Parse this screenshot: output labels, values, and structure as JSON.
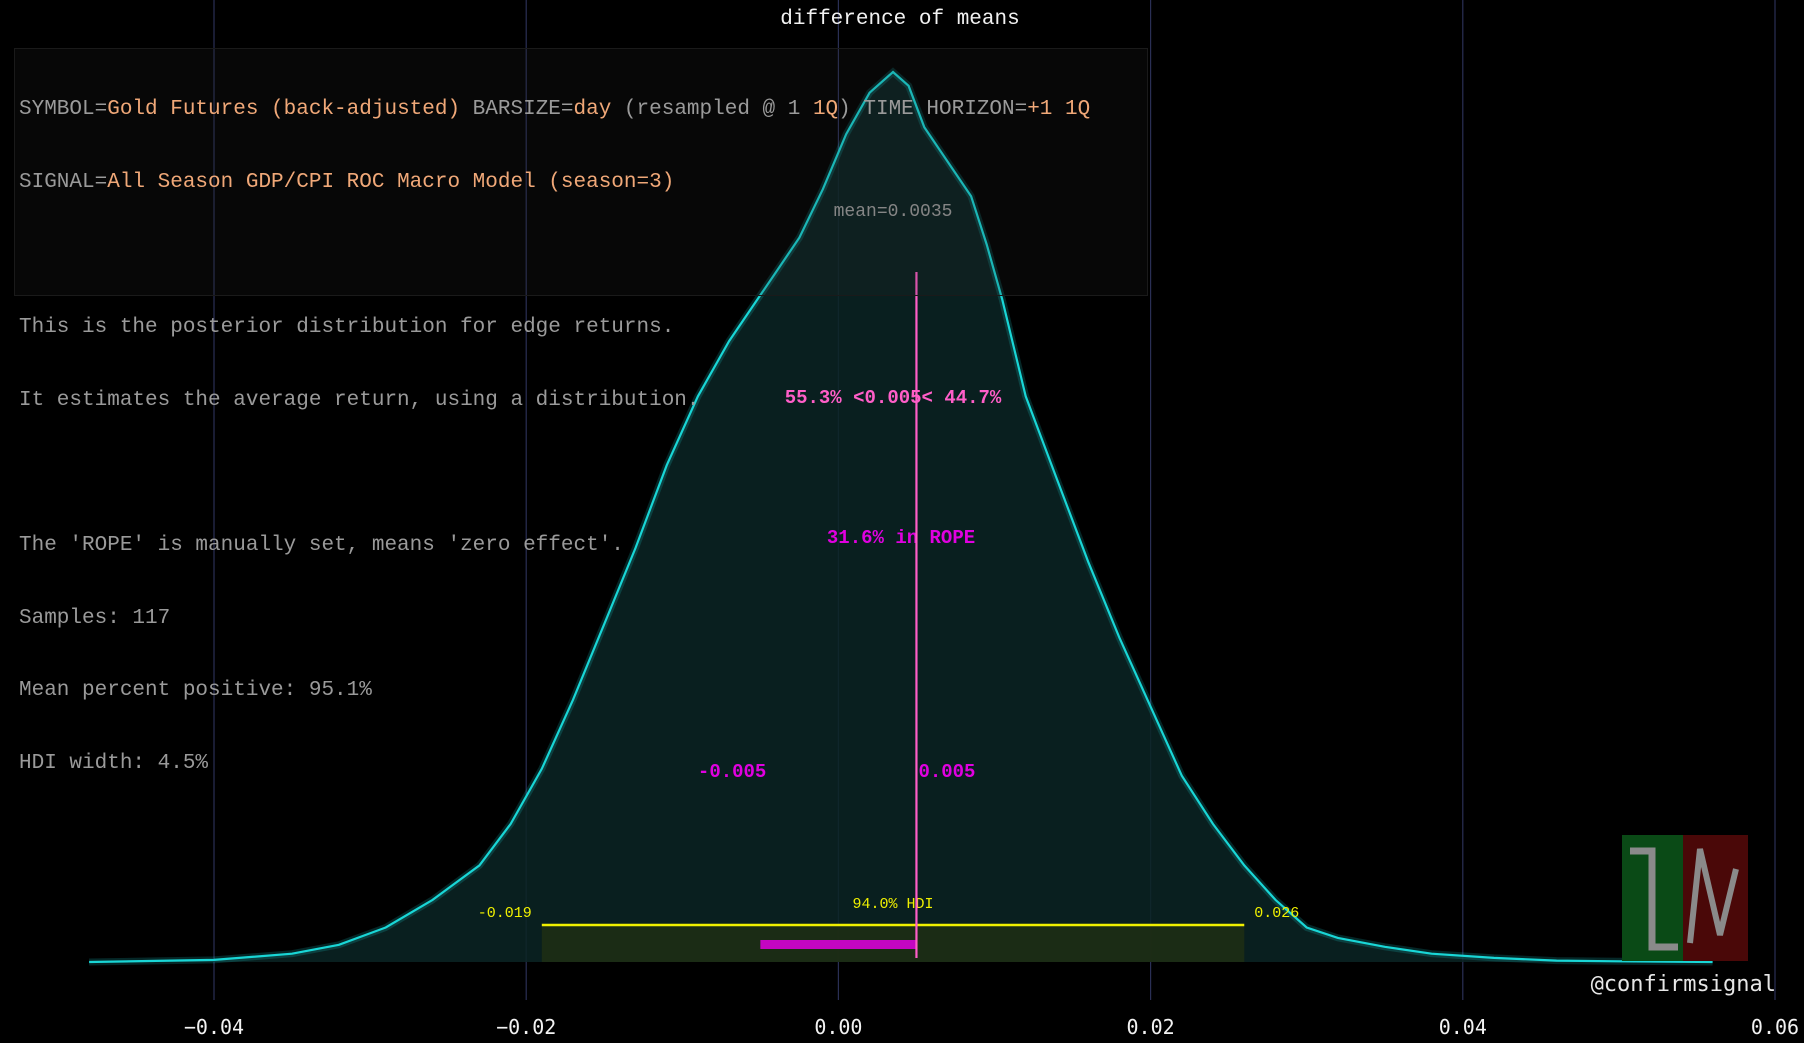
{
  "chart_data": {
    "type": "area",
    "title": "difference of means",
    "xlim": [
      -0.05,
      0.06
    ],
    "xticks": [
      -0.04,
      -0.02,
      0.0,
      0.02,
      0.04,
      0.06
    ],
    "xtick_labels": [
      "−0.04",
      "−0.02",
      "0.00",
      "0.02",
      "0.04",
      "0.06"
    ],
    "grid": "vertical",
    "density": {
      "x": [
        -0.048,
        -0.04,
        -0.035,
        -0.032,
        -0.029,
        -0.026,
        -0.023,
        -0.021,
        -0.019,
        -0.017,
        -0.015,
        -0.013,
        -0.011,
        -0.009,
        -0.007,
        -0.0055,
        -0.004,
        -0.0025,
        -0.001,
        0.0005,
        0.002,
        0.0035,
        0.0045,
        0.0055,
        0.007,
        0.0085,
        0.0095,
        0.0105,
        0.012,
        0.014,
        0.016,
        0.018,
        0.02,
        0.022,
        0.024,
        0.026,
        0.028,
        0.03,
        0.032,
        0.035,
        0.038,
        0.042,
        0.046,
        0.05,
        0.056
      ],
      "y": [
        0.0,
        0.003,
        0.012,
        0.025,
        0.05,
        0.09,
        0.14,
        0.2,
        0.28,
        0.38,
        0.49,
        0.6,
        0.72,
        0.82,
        0.9,
        0.95,
        1.0,
        1.05,
        1.12,
        1.2,
        1.26,
        1.29,
        1.27,
        1.21,
        1.16,
        1.11,
        1.04,
        0.96,
        0.82,
        0.7,
        0.58,
        0.47,
        0.37,
        0.27,
        0.2,
        0.14,
        0.09,
        0.05,
        0.035,
        0.022,
        0.012,
        0.006,
        0.002,
        0.001,
        0.0
      ]
    },
    "mean": 0.0035,
    "mean_label": "mean=0.0035",
    "reference_value": 0.005,
    "reference_label": "55.3% <0.005< 44.7%",
    "rope": [
      -0.005,
      0.005
    ],
    "rope_labels": [
      "-0.005",
      "0.005"
    ],
    "rope_text": "31.6% in ROPE",
    "hdi": [
      -0.019,
      0.026
    ],
    "hdi_labels": [
      "-0.019",
      "0.026"
    ],
    "hdi_text": "94.0% HDI"
  },
  "info": {
    "symbol_key": "SYMBOL=",
    "symbol_value": "Gold Futures (back-adjusted)",
    "barsize_key": " BARSIZE=",
    "barsize_value": "day",
    "resample_text": " (resampled @ 1 ",
    "resample_value": "1Q",
    "resample_close": ") TIME HORIZON=",
    "horizon_value": "+1 1Q",
    "signal_key": "SIGNAL=",
    "signal_value": "All Season GDP/CPI ROC Macro Model (season=3)",
    "desc_line1": "This is the posterior distribution for edge returns.",
    "desc_line2": "It estimates the average return, using a distribution.",
    "rope_note": "The 'ROPE' is manually set, means 'zero effect'.",
    "samples": "Samples: 117",
    "mean_positive": "Mean percent positive: 95.1%",
    "hdi_width": "HDI width: 4.5%"
  },
  "watermark": "@confirmsignal",
  "colors": {
    "background": "#000000",
    "curve": "#19d6d6",
    "curve_fill": "#0a2424",
    "grid": "#2a2f55",
    "rope": "#e000e0",
    "reference": "#ff5ec8",
    "hdi": "#f0f000",
    "hdi_fill": "#1e2e14",
    "label_orange": "#f0a878",
    "text_gray": "#9a9a9a",
    "logo_green": "#0a4a16",
    "logo_red": "#4a0808"
  }
}
